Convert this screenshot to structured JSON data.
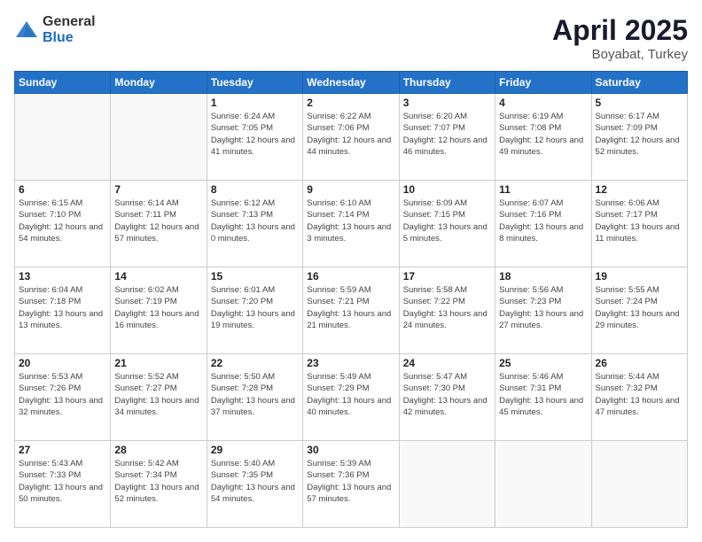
{
  "logo": {
    "general": "General",
    "blue": "Blue"
  },
  "title": {
    "month": "April 2025",
    "location": "Boyabat, Turkey"
  },
  "days_header": [
    "Sunday",
    "Monday",
    "Tuesday",
    "Wednesday",
    "Thursday",
    "Friday",
    "Saturday"
  ],
  "weeks": [
    [
      {
        "day": "",
        "info": ""
      },
      {
        "day": "",
        "info": ""
      },
      {
        "day": "1",
        "info": "Sunrise: 6:24 AM\nSunset: 7:05 PM\nDaylight: 12 hours and 41 minutes."
      },
      {
        "day": "2",
        "info": "Sunrise: 6:22 AM\nSunset: 7:06 PM\nDaylight: 12 hours and 44 minutes."
      },
      {
        "day": "3",
        "info": "Sunrise: 6:20 AM\nSunset: 7:07 PM\nDaylight: 12 hours and 46 minutes."
      },
      {
        "day": "4",
        "info": "Sunrise: 6:19 AM\nSunset: 7:08 PM\nDaylight: 12 hours and 49 minutes."
      },
      {
        "day": "5",
        "info": "Sunrise: 6:17 AM\nSunset: 7:09 PM\nDaylight: 12 hours and 52 minutes."
      }
    ],
    [
      {
        "day": "6",
        "info": "Sunrise: 6:15 AM\nSunset: 7:10 PM\nDaylight: 12 hours and 54 minutes."
      },
      {
        "day": "7",
        "info": "Sunrise: 6:14 AM\nSunset: 7:11 PM\nDaylight: 12 hours and 57 minutes."
      },
      {
        "day": "8",
        "info": "Sunrise: 6:12 AM\nSunset: 7:13 PM\nDaylight: 13 hours and 0 minutes."
      },
      {
        "day": "9",
        "info": "Sunrise: 6:10 AM\nSunset: 7:14 PM\nDaylight: 13 hours and 3 minutes."
      },
      {
        "day": "10",
        "info": "Sunrise: 6:09 AM\nSunset: 7:15 PM\nDaylight: 13 hours and 5 minutes."
      },
      {
        "day": "11",
        "info": "Sunrise: 6:07 AM\nSunset: 7:16 PM\nDaylight: 13 hours and 8 minutes."
      },
      {
        "day": "12",
        "info": "Sunrise: 6:06 AM\nSunset: 7:17 PM\nDaylight: 13 hours and 11 minutes."
      }
    ],
    [
      {
        "day": "13",
        "info": "Sunrise: 6:04 AM\nSunset: 7:18 PM\nDaylight: 13 hours and 13 minutes."
      },
      {
        "day": "14",
        "info": "Sunrise: 6:02 AM\nSunset: 7:19 PM\nDaylight: 13 hours and 16 minutes."
      },
      {
        "day": "15",
        "info": "Sunrise: 6:01 AM\nSunset: 7:20 PM\nDaylight: 13 hours and 19 minutes."
      },
      {
        "day": "16",
        "info": "Sunrise: 5:59 AM\nSunset: 7:21 PM\nDaylight: 13 hours and 21 minutes."
      },
      {
        "day": "17",
        "info": "Sunrise: 5:58 AM\nSunset: 7:22 PM\nDaylight: 13 hours and 24 minutes."
      },
      {
        "day": "18",
        "info": "Sunrise: 5:56 AM\nSunset: 7:23 PM\nDaylight: 13 hours and 27 minutes."
      },
      {
        "day": "19",
        "info": "Sunrise: 5:55 AM\nSunset: 7:24 PM\nDaylight: 13 hours and 29 minutes."
      }
    ],
    [
      {
        "day": "20",
        "info": "Sunrise: 5:53 AM\nSunset: 7:26 PM\nDaylight: 13 hours and 32 minutes."
      },
      {
        "day": "21",
        "info": "Sunrise: 5:52 AM\nSunset: 7:27 PM\nDaylight: 13 hours and 34 minutes."
      },
      {
        "day": "22",
        "info": "Sunrise: 5:50 AM\nSunset: 7:28 PM\nDaylight: 13 hours and 37 minutes."
      },
      {
        "day": "23",
        "info": "Sunrise: 5:49 AM\nSunset: 7:29 PM\nDaylight: 13 hours and 40 minutes."
      },
      {
        "day": "24",
        "info": "Sunrise: 5:47 AM\nSunset: 7:30 PM\nDaylight: 13 hours and 42 minutes."
      },
      {
        "day": "25",
        "info": "Sunrise: 5:46 AM\nSunset: 7:31 PM\nDaylight: 13 hours and 45 minutes."
      },
      {
        "day": "26",
        "info": "Sunrise: 5:44 AM\nSunset: 7:32 PM\nDaylight: 13 hours and 47 minutes."
      }
    ],
    [
      {
        "day": "27",
        "info": "Sunrise: 5:43 AM\nSunset: 7:33 PM\nDaylight: 13 hours and 50 minutes."
      },
      {
        "day": "28",
        "info": "Sunrise: 5:42 AM\nSunset: 7:34 PM\nDaylight: 13 hours and 52 minutes."
      },
      {
        "day": "29",
        "info": "Sunrise: 5:40 AM\nSunset: 7:35 PM\nDaylight: 13 hours and 54 minutes."
      },
      {
        "day": "30",
        "info": "Sunrise: 5:39 AM\nSunset: 7:36 PM\nDaylight: 13 hours and 57 minutes."
      },
      {
        "day": "",
        "info": ""
      },
      {
        "day": "",
        "info": ""
      },
      {
        "day": "",
        "info": ""
      }
    ]
  ]
}
